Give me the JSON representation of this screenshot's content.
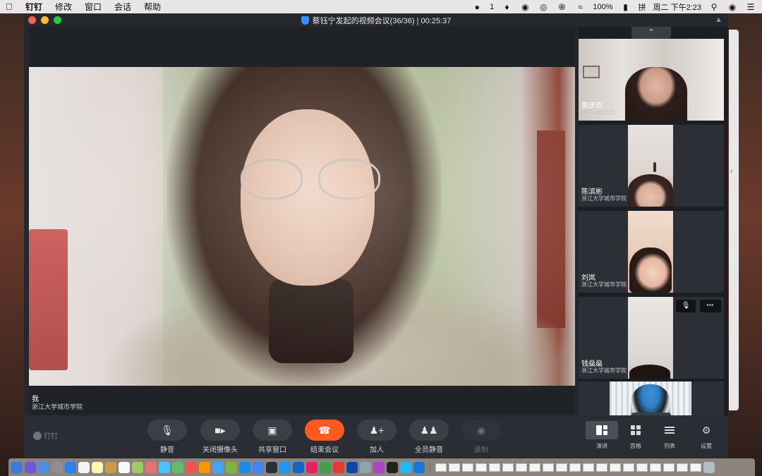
{
  "menubar": {
    "app_name": "钉钉",
    "menus": [
      "修改",
      "窗口",
      "会话",
      "帮助"
    ],
    "status": {
      "badge": "1",
      "battery": "100%",
      "input_method": "拼",
      "clock": "周二 下午2:23"
    }
  },
  "window": {
    "title": "蔡钰宁发起的视频会议(36/36) | 00:25:37"
  },
  "main_video": {
    "name": "我",
    "org": "浙江大学城市学院"
  },
  "participants": [
    {
      "name": "黄庆欢",
      "org": "浙江省教育厅"
    },
    {
      "name": "陈滨彬",
      "org": "浙江大学城市学院"
    },
    {
      "name": "刘岚",
      "org": "浙江大学城市学院"
    },
    {
      "name": "钱燊燊",
      "org": "浙江大学城市学院"
    },
    {
      "name": "",
      "org": ""
    }
  ],
  "toolbar": {
    "brand": "钉钉",
    "controls": [
      {
        "label": "静音",
        "icon": "microphone-icon"
      },
      {
        "label": "关闭摄像头",
        "icon": "camera-icon"
      },
      {
        "label": "共享窗口",
        "icon": "share-screen-icon"
      },
      {
        "label": "结束会议",
        "icon": "end-call-icon"
      },
      {
        "label": "加人",
        "icon": "add-person-icon"
      },
      {
        "label": "全员静音",
        "icon": "mute-all-icon"
      },
      {
        "label": "录制",
        "icon": "record-icon"
      }
    ],
    "views": [
      {
        "label": "演讲",
        "icon": "speaker-view-icon"
      },
      {
        "label": "宫格",
        "icon": "gallery-view-icon"
      },
      {
        "label": "列表",
        "icon": "list-view-icon"
      },
      {
        "label": "设置",
        "icon": "gear-icon"
      }
    ]
  },
  "colors": {
    "end_call": "#ff5a1f",
    "window_bg": "#24272c",
    "toolbar_bg": "#2a2d33"
  }
}
